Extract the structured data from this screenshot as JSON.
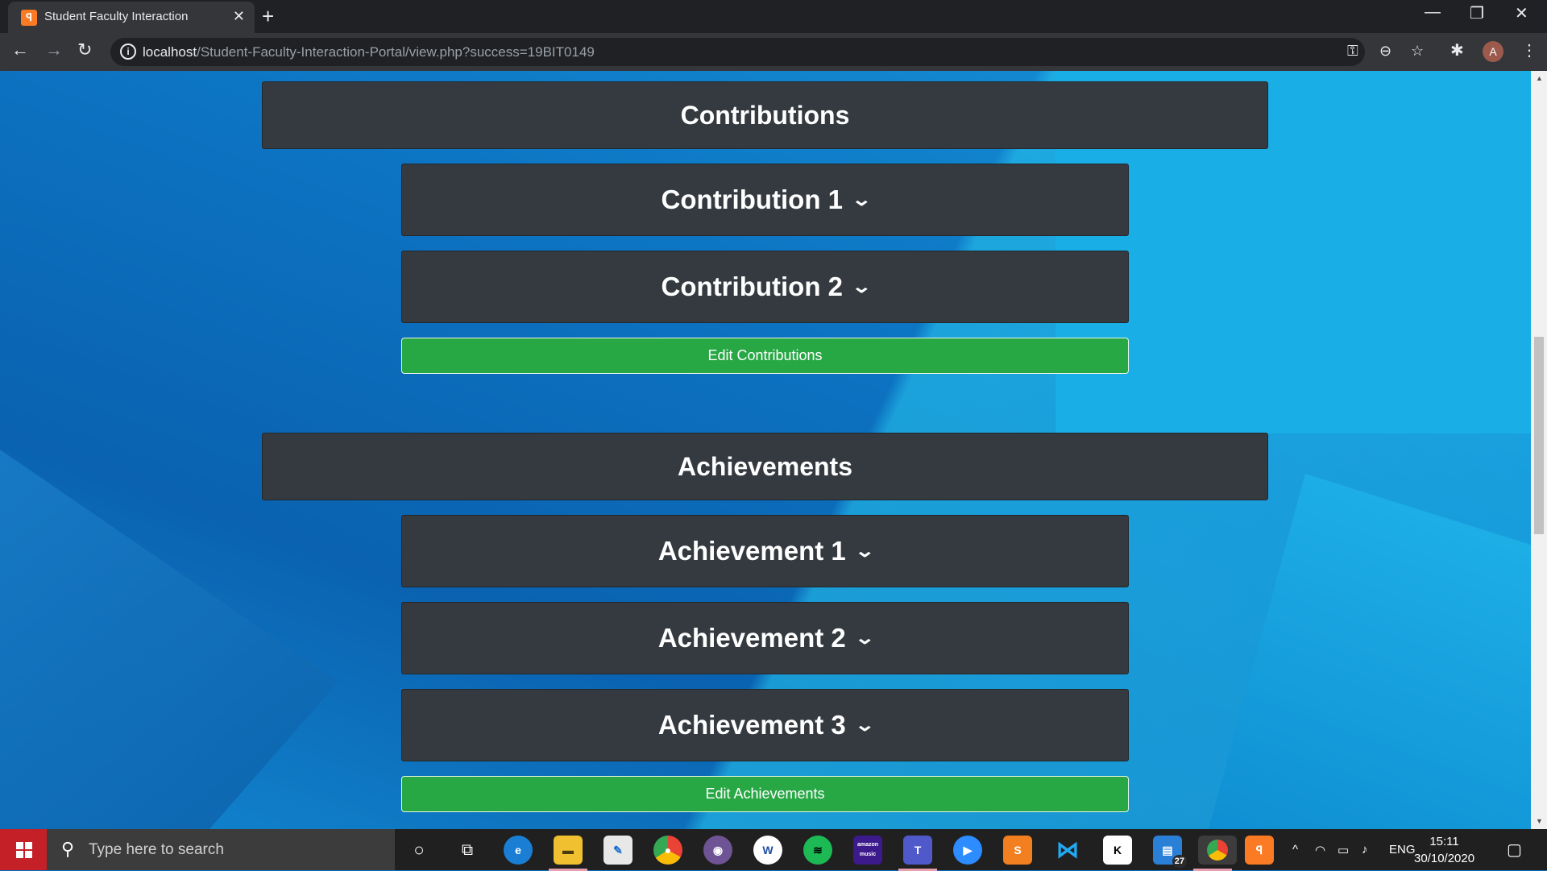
{
  "browser": {
    "tab_title": "Student Faculty Interaction",
    "tab_icon": "xampp-icon",
    "url_host": "localhost",
    "url_path": "/Student-Faculty-Interaction-Portal/view.php?success=19BIT0149",
    "profile_initial": "A"
  },
  "page": {
    "contributions": {
      "heading": "Contributions",
      "items": [
        "Contribution 1",
        "Contribution 2"
      ],
      "edit_label": "Edit Contributions"
    },
    "achievements": {
      "heading": "Achievements",
      "items": [
        "Achievement 1",
        "Achievement 2",
        "Achievement 3"
      ],
      "edit_label": "Edit Achievements"
    },
    "colors": {
      "panel": "#343a40",
      "button_green": "#28a745"
    }
  },
  "taskbar": {
    "search_placeholder": "Type here to search",
    "language": "ENG",
    "time": "15:11",
    "date": "30/10/2020",
    "badge_count": "27",
    "amazon_music_label": "amazon music"
  }
}
